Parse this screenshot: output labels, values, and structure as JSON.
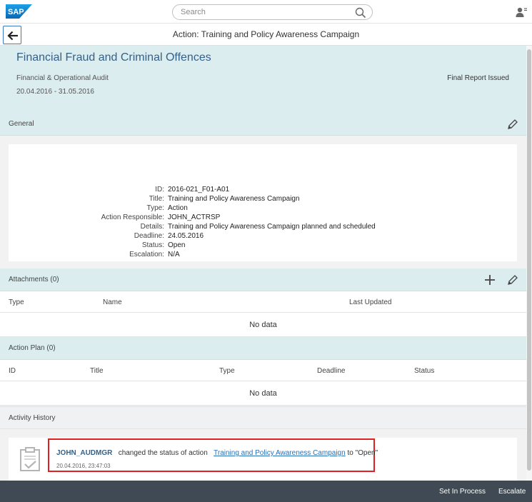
{
  "shell": {
    "logo": "SAP",
    "search_placeholder": "Search",
    "search_value": ""
  },
  "titlebar": {
    "title": "Action: Training and Policy Awareness Campaign"
  },
  "header": {
    "title": "Financial Fraud and Criminal Offences",
    "subtitle": "Financial & Operational Audit",
    "period": "20.04.2016 - 31.05.2016",
    "status": "Final Report Issued"
  },
  "general": {
    "section_title": "General",
    "fields": [
      {
        "label": "ID:",
        "value": "2016-021_F01-A01"
      },
      {
        "label": "Title:",
        "value": "Training and Policy Awareness Campaign"
      },
      {
        "label": "Type:",
        "value": "Action"
      },
      {
        "label": "Action Responsible:",
        "value": "JOHN_ACTRSP"
      },
      {
        "label": "Details:",
        "value": "Training and Policy Awareness Campaign planned and scheduled"
      },
      {
        "label": "Deadline:",
        "value": "24.05.2016"
      },
      {
        "label": "Status:",
        "value": "Open"
      },
      {
        "label": "Escalation:",
        "value": "N/A"
      }
    ]
  },
  "attachments": {
    "section_title": "Attachments (0)",
    "columns": [
      "Type",
      "Name",
      "Last Updated"
    ],
    "empty_text": "No data"
  },
  "action_plan": {
    "section_title": "Action Plan (0)",
    "columns": [
      "ID",
      "Title",
      "Type",
      "Deadline",
      "Status"
    ],
    "empty_text": "No data"
  },
  "activity": {
    "section_title": "Activity History",
    "user": "JOHN_AUDMGR",
    "text_before": "changed the status of action",
    "link": "Training and Policy Awareness Campaign",
    "text_after": "to \"Open\"",
    "timestamp": "20.04.2016, 23:47:03"
  },
  "footer": {
    "set_in_process": "Set In Process",
    "escalate": "Escalate"
  },
  "colors": {
    "header_bg": "#dcedf0",
    "title_blue": "#346187",
    "link_blue": "#2a6fb5",
    "footer_bg": "#3f4a54",
    "highlight_red": "#e02020"
  }
}
